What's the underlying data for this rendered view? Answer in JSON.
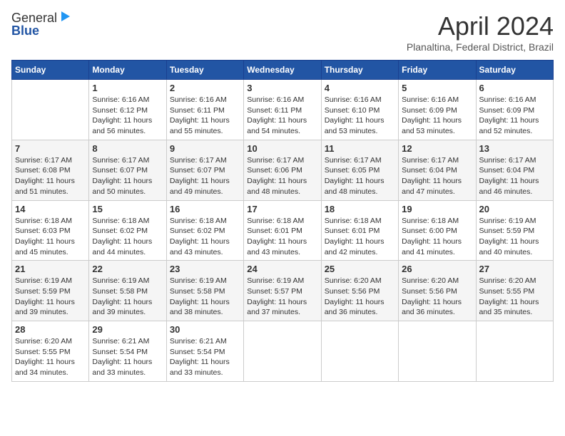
{
  "header": {
    "logo_general": "General",
    "logo_blue": "Blue",
    "month_title": "April 2024",
    "location": "Planaltina, Federal District, Brazil"
  },
  "columns": [
    "Sunday",
    "Monday",
    "Tuesday",
    "Wednesday",
    "Thursday",
    "Friday",
    "Saturday"
  ],
  "weeks": [
    [
      {
        "day": "",
        "detail": ""
      },
      {
        "day": "1",
        "detail": "Sunrise: 6:16 AM\nSunset: 6:12 PM\nDaylight: 11 hours\nand 56 minutes."
      },
      {
        "day": "2",
        "detail": "Sunrise: 6:16 AM\nSunset: 6:11 PM\nDaylight: 11 hours\nand 55 minutes."
      },
      {
        "day": "3",
        "detail": "Sunrise: 6:16 AM\nSunset: 6:11 PM\nDaylight: 11 hours\nand 54 minutes."
      },
      {
        "day": "4",
        "detail": "Sunrise: 6:16 AM\nSunset: 6:10 PM\nDaylight: 11 hours\nand 53 minutes."
      },
      {
        "day": "5",
        "detail": "Sunrise: 6:16 AM\nSunset: 6:09 PM\nDaylight: 11 hours\nand 53 minutes."
      },
      {
        "day": "6",
        "detail": "Sunrise: 6:16 AM\nSunset: 6:09 PM\nDaylight: 11 hours\nand 52 minutes."
      }
    ],
    [
      {
        "day": "7",
        "detail": "Sunrise: 6:17 AM\nSunset: 6:08 PM\nDaylight: 11 hours\nand 51 minutes."
      },
      {
        "day": "8",
        "detail": "Sunrise: 6:17 AM\nSunset: 6:07 PM\nDaylight: 11 hours\nand 50 minutes."
      },
      {
        "day": "9",
        "detail": "Sunrise: 6:17 AM\nSunset: 6:07 PM\nDaylight: 11 hours\nand 49 minutes."
      },
      {
        "day": "10",
        "detail": "Sunrise: 6:17 AM\nSunset: 6:06 PM\nDaylight: 11 hours\nand 48 minutes."
      },
      {
        "day": "11",
        "detail": "Sunrise: 6:17 AM\nSunset: 6:05 PM\nDaylight: 11 hours\nand 48 minutes."
      },
      {
        "day": "12",
        "detail": "Sunrise: 6:17 AM\nSunset: 6:04 PM\nDaylight: 11 hours\nand 47 minutes."
      },
      {
        "day": "13",
        "detail": "Sunrise: 6:17 AM\nSunset: 6:04 PM\nDaylight: 11 hours\nand 46 minutes."
      }
    ],
    [
      {
        "day": "14",
        "detail": "Sunrise: 6:18 AM\nSunset: 6:03 PM\nDaylight: 11 hours\nand 45 minutes."
      },
      {
        "day": "15",
        "detail": "Sunrise: 6:18 AM\nSunset: 6:02 PM\nDaylight: 11 hours\nand 44 minutes."
      },
      {
        "day": "16",
        "detail": "Sunrise: 6:18 AM\nSunset: 6:02 PM\nDaylight: 11 hours\nand 43 minutes."
      },
      {
        "day": "17",
        "detail": "Sunrise: 6:18 AM\nSunset: 6:01 PM\nDaylight: 11 hours\nand 43 minutes."
      },
      {
        "day": "18",
        "detail": "Sunrise: 6:18 AM\nSunset: 6:01 PM\nDaylight: 11 hours\nand 42 minutes."
      },
      {
        "day": "19",
        "detail": "Sunrise: 6:18 AM\nSunset: 6:00 PM\nDaylight: 11 hours\nand 41 minutes."
      },
      {
        "day": "20",
        "detail": "Sunrise: 6:19 AM\nSunset: 5:59 PM\nDaylight: 11 hours\nand 40 minutes."
      }
    ],
    [
      {
        "day": "21",
        "detail": "Sunrise: 6:19 AM\nSunset: 5:59 PM\nDaylight: 11 hours\nand 39 minutes."
      },
      {
        "day": "22",
        "detail": "Sunrise: 6:19 AM\nSunset: 5:58 PM\nDaylight: 11 hours\nand 39 minutes."
      },
      {
        "day": "23",
        "detail": "Sunrise: 6:19 AM\nSunset: 5:58 PM\nDaylight: 11 hours\nand 38 minutes."
      },
      {
        "day": "24",
        "detail": "Sunrise: 6:19 AM\nSunset: 5:57 PM\nDaylight: 11 hours\nand 37 minutes."
      },
      {
        "day": "25",
        "detail": "Sunrise: 6:20 AM\nSunset: 5:56 PM\nDaylight: 11 hours\nand 36 minutes."
      },
      {
        "day": "26",
        "detail": "Sunrise: 6:20 AM\nSunset: 5:56 PM\nDaylight: 11 hours\nand 36 minutes."
      },
      {
        "day": "27",
        "detail": "Sunrise: 6:20 AM\nSunset: 5:55 PM\nDaylight: 11 hours\nand 35 minutes."
      }
    ],
    [
      {
        "day": "28",
        "detail": "Sunrise: 6:20 AM\nSunset: 5:55 PM\nDaylight: 11 hours\nand 34 minutes."
      },
      {
        "day": "29",
        "detail": "Sunrise: 6:21 AM\nSunset: 5:54 PM\nDaylight: 11 hours\nand 33 minutes."
      },
      {
        "day": "30",
        "detail": "Sunrise: 6:21 AM\nSunset: 5:54 PM\nDaylight: 11 hours\nand 33 minutes."
      },
      {
        "day": "",
        "detail": ""
      },
      {
        "day": "",
        "detail": ""
      },
      {
        "day": "",
        "detail": ""
      },
      {
        "day": "",
        "detail": ""
      }
    ]
  ]
}
